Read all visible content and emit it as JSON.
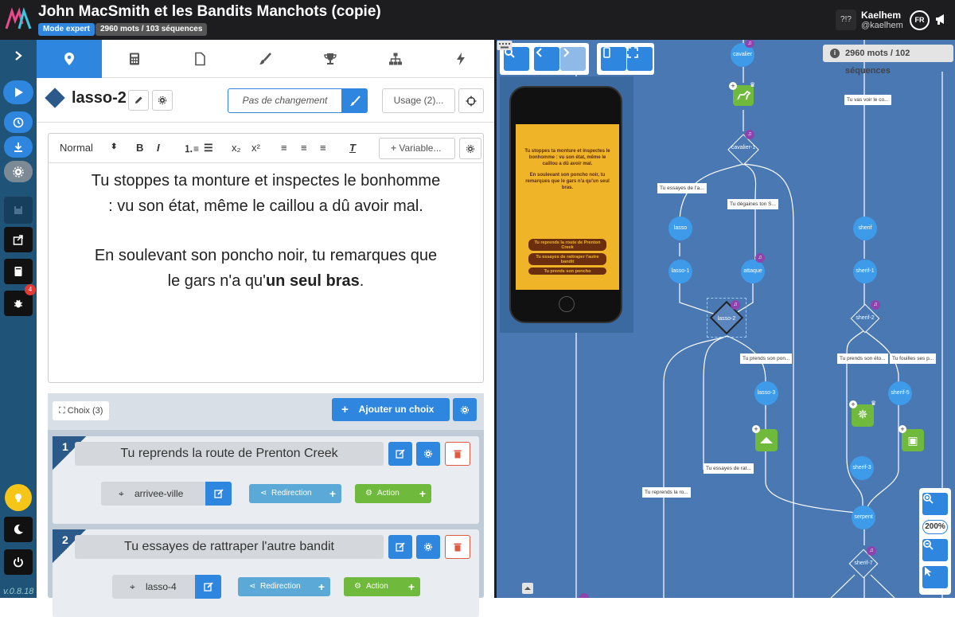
{
  "app": {
    "title": "John MacSmith et les Bandits Manchots (copie)",
    "mode_badge": "Mode expert",
    "count_badge": "2960 mots / 103 séquences",
    "help": "?!?",
    "user_name": "Kaelhem",
    "user_handle": "@kaelhem",
    "lang": "FR",
    "version": "v.0.8.18",
    "bug_count": "4"
  },
  "node": {
    "name": "lasso-2",
    "no_change": "Pas de changement",
    "usage": "Usage (2)..."
  },
  "editor": {
    "style_select": "Normal",
    "sub": "x₂",
    "sup": "x²",
    "variable": "Variable...",
    "para1": "Tu stoppes ta monture et inspectes le bonhomme : vu son état, même le caillou a dû avoir mal.",
    "para2_pre": "En soulevant son poncho noir, tu remarques que le gars n'a qu'",
    "para2_bold": "un seul bras",
    "para2_post": "."
  },
  "choices": {
    "label": "Choix (3)",
    "add_label": "Ajouter un choix",
    "items": [
      {
        "num": "1",
        "title": "Tu reprends la route de Prenton Creek",
        "target": "arrivee-ville",
        "redirection": "Redirection",
        "action": "Action"
      },
      {
        "num": "2",
        "title": "Tu essayes de rattraper l'autre bandit",
        "target": "lasso-4",
        "redirection": "Redirection",
        "action": "Action"
      }
    ]
  },
  "graph": {
    "stats": "2960 mots / 102 séquences",
    "zoom": "200%",
    "nodes": {
      "cavalier": "cavalier",
      "cavalier1": "cavalier-1",
      "lasso": "lasso",
      "lasso1": "lasso-1",
      "attaque": "attaque",
      "lasso2": "lasso-2",
      "lasso3": "lasso-3",
      "sherif": "sherif",
      "sherif1": "sherif-1",
      "sherif2": "sherif-2",
      "sherif3": "sherif-3",
      "sherif5": "sherif-5",
      "serpent": "serpent",
      "sherif7": "sherif-7"
    },
    "labels": {
      "l1": "Tu vas voir le co...",
      "l2": "Tu essayes de l'a...",
      "l3": "Tu dégaines ton S...",
      "l4": "Tu prends son pon...",
      "l5": "Tu essayes de rat...",
      "l6": "Tu reprends la ro...",
      "l7": "Tu prends son éto...",
      "l8": "Tu fouilles ses p..."
    }
  },
  "phone": {
    "text1": "Tu stoppes ta monture et inspectes le bonhomme : vu son état, même le caillou a dû avoir mal.",
    "text2": "En soulevant son poncho noir, tu remarques que le gars n'a qu'un seul bras.",
    "c1": "Tu reprends la route de Prenton Creek",
    "c2": "Tu essayes de rattraper l'autre bandit",
    "c3": "Tu prends son poncho"
  },
  "colors": {
    "accent": "#2e86de",
    "rail": "#1f5378",
    "graph_bg": "#4a78b3",
    "node_blue": "#3d9be9",
    "action_green": "#6fb93c",
    "screen": "#f0b429"
  }
}
